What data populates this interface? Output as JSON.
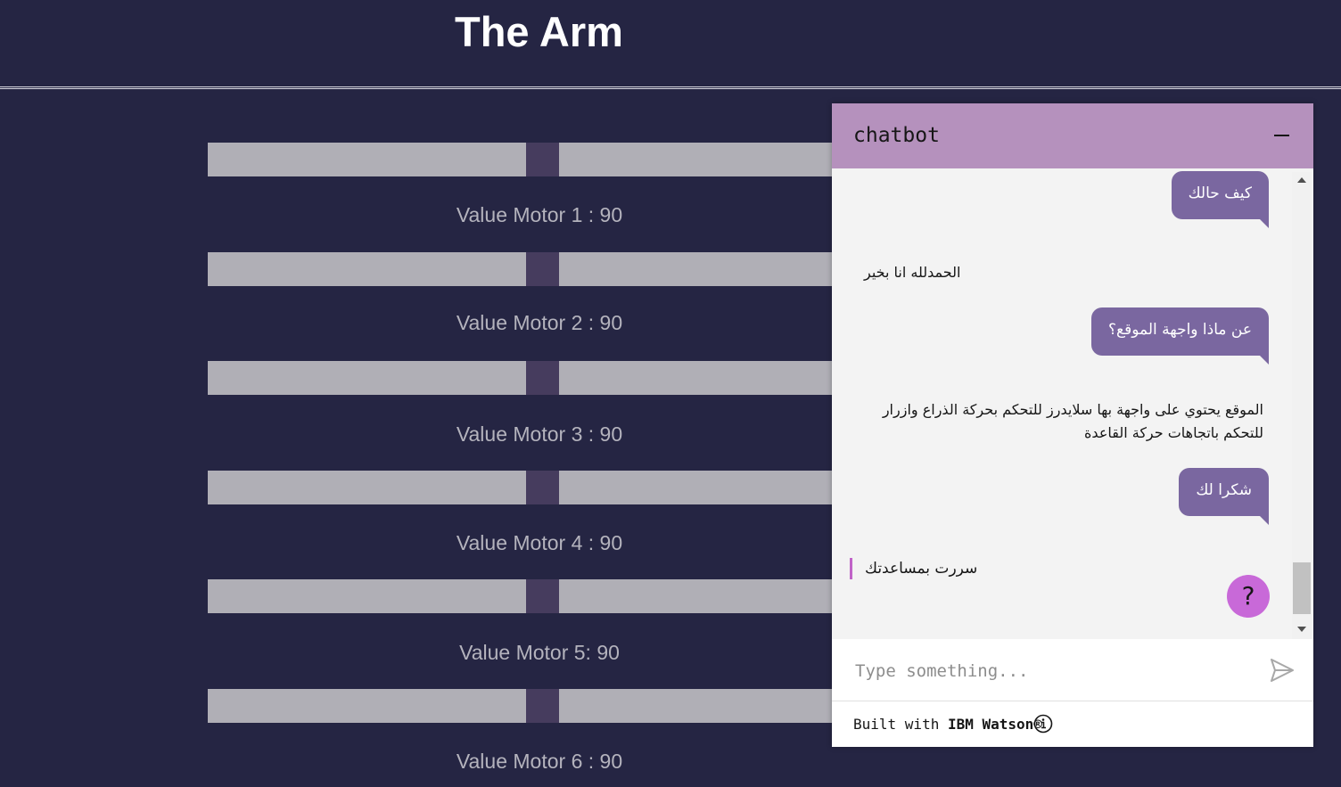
{
  "page": {
    "title": "The Arm"
  },
  "motors": [
    {
      "label": "Value Motor 1 : 90",
      "value": 90
    },
    {
      "label": "Value Motor 2 : 90",
      "value": 90
    },
    {
      "label": "Value Motor 3 : 90",
      "value": 90
    },
    {
      "label": "Value Motor 4 : 90",
      "value": 90
    },
    {
      "label": "Value Motor 5: 90",
      "value": 90
    },
    {
      "label": "Value Motor 6 : 90",
      "value": 90
    }
  ],
  "chat": {
    "title": "chatbot",
    "messages": [
      {
        "from": "user",
        "text": "كيف حالك"
      },
      {
        "from": "bot",
        "text": "الحمدلله انا بخير"
      },
      {
        "from": "user",
        "text": "عن ماذا واجهة الموقع؟"
      },
      {
        "from": "bot",
        "text": "الموقع يحتوي على واجهة بها سلايدرز للتحكم بحركة الذراع وازرار للتحكم باتجاهات حركة القاعدة"
      },
      {
        "from": "user",
        "text": "شكرا لك"
      },
      {
        "from": "bot",
        "text": "سررت بمساعدتك"
      }
    ],
    "help_label": "?",
    "input_placeholder": "Type something...",
    "input_value": "",
    "footer_prefix": "Built with ",
    "footer_brand": "IBM Watson®"
  },
  "colors": {
    "background": "#252543",
    "slider_track": "#b0afb6",
    "slider_thumb": "#463c5e",
    "chat_header": "#b591bd",
    "user_bubble": "#7a67a0",
    "help_button": "#c869d8"
  },
  "icons": {
    "minimize": "minimize-icon",
    "send": "send-icon",
    "info": "info-icon",
    "help": "help-icon"
  }
}
